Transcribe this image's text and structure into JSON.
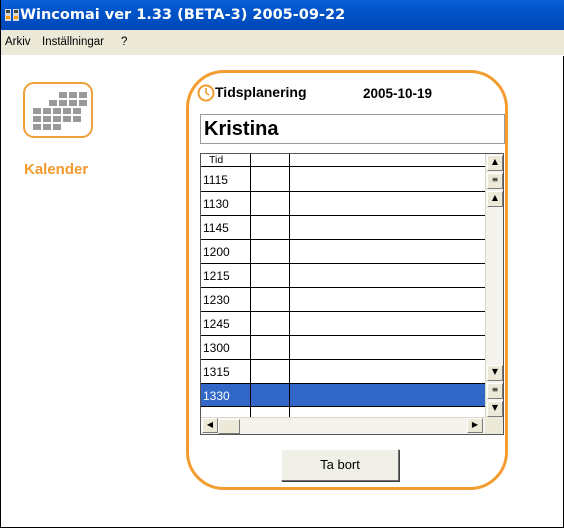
{
  "window": {
    "title": "Wincomai ver 1.33 (BETA-3) 2005-09-22",
    "icon": "app-icon"
  },
  "menu": [
    {
      "label": "Arkiv"
    },
    {
      "label": "Inställningar"
    },
    {
      "label": "?"
    }
  ],
  "sidebar": {
    "calendar_label": "Kalender",
    "calendar_icon": "calendar-grid-icon"
  },
  "panel": {
    "title": "Tidsplanering",
    "date": "2005-10-19",
    "name": "Kristina",
    "clock_icon": "clock-icon",
    "grid": {
      "header": [
        "Tid",
        "",
        ""
      ],
      "rows": [
        "1115",
        "1130",
        "1145",
        "1200",
        "1215",
        "1230",
        "1245",
        "1300",
        "1315",
        "1330"
      ],
      "selected_row": "1330"
    },
    "delete_button": "Ta bort"
  },
  "colors": {
    "accent": "#f39c2f",
    "titlebar": "#0053c8",
    "selection": "#3168c8"
  }
}
